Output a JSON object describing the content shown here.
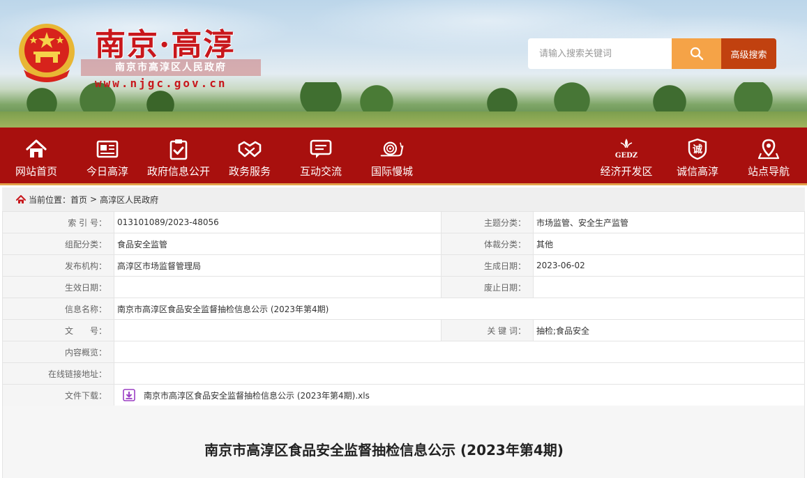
{
  "header": {
    "site_title": "南京·高淳",
    "gov_name": "南京市高淳区人民政府",
    "site_url": "www.njgc.gov.cn",
    "search_placeholder": "请输入搜索关键词",
    "advanced_search_label": "高级搜索",
    "accent_color": "#a8100e"
  },
  "nav": {
    "left": [
      {
        "label": "网站首页",
        "icon": "home-icon"
      },
      {
        "label": "今日高淳",
        "icon": "newspaper-icon"
      },
      {
        "label": "政府信息公开",
        "icon": "clipboard-check-icon"
      },
      {
        "label": "政务服务",
        "icon": "handshake-icon"
      },
      {
        "label": "互动交流",
        "icon": "chat-icon"
      },
      {
        "label": "国际慢城",
        "icon": "snail-icon"
      }
    ],
    "right": [
      {
        "label": "经济开发区",
        "icon": "gedz-logo-icon",
        "logo_text": "GEDZ"
      },
      {
        "label": "诚信高淳",
        "icon": "integrity-badge-icon",
        "badge_char": "诚"
      },
      {
        "label": "站点导航",
        "icon": "location-pin-icon"
      }
    ]
  },
  "breadcrumb": {
    "prefix": "当前位置：",
    "items": [
      "首页",
      "高淳区人民政府"
    ],
    "separator": ">"
  },
  "meta": {
    "index_label": "索 引 号：",
    "index_value": "013101089/2023-48056",
    "topic_label": "主题分类：",
    "topic_value": "市场监管、安全生产监管",
    "org_class_label": "组配分类：",
    "org_class_value": "食品安全监管",
    "genre_label": "体裁分类：",
    "genre_value": "其他",
    "publisher_label": "发布机构：",
    "publisher_value": "高淳区市场监督管理局",
    "created_label": "生成日期：",
    "created_value": "2023-06-02",
    "effective_label": "生效日期：",
    "effective_value": "",
    "abolish_label": "废止日期：",
    "abolish_value": "",
    "info_name_label": "信息名称：",
    "info_name_value": "南京市高淳区食品安全监督抽检信息公示 (2023年第4期)",
    "doc_no_label": "文　　号：",
    "doc_no_value": "",
    "keywords_label": "关 键 词：",
    "keywords_value": "抽检;食品安全",
    "summary_label": "内容概览：",
    "summary_value": "",
    "link_label": "在线链接地址：",
    "link_value": "",
    "download_label": "文件下载：",
    "download_file": "南京市高淳区食品安全监督抽检信息公示 (2023年第4期).xls"
  },
  "article": {
    "title": "南京市高淳区食品安全监督抽检信息公示 (2023年第4期)"
  }
}
